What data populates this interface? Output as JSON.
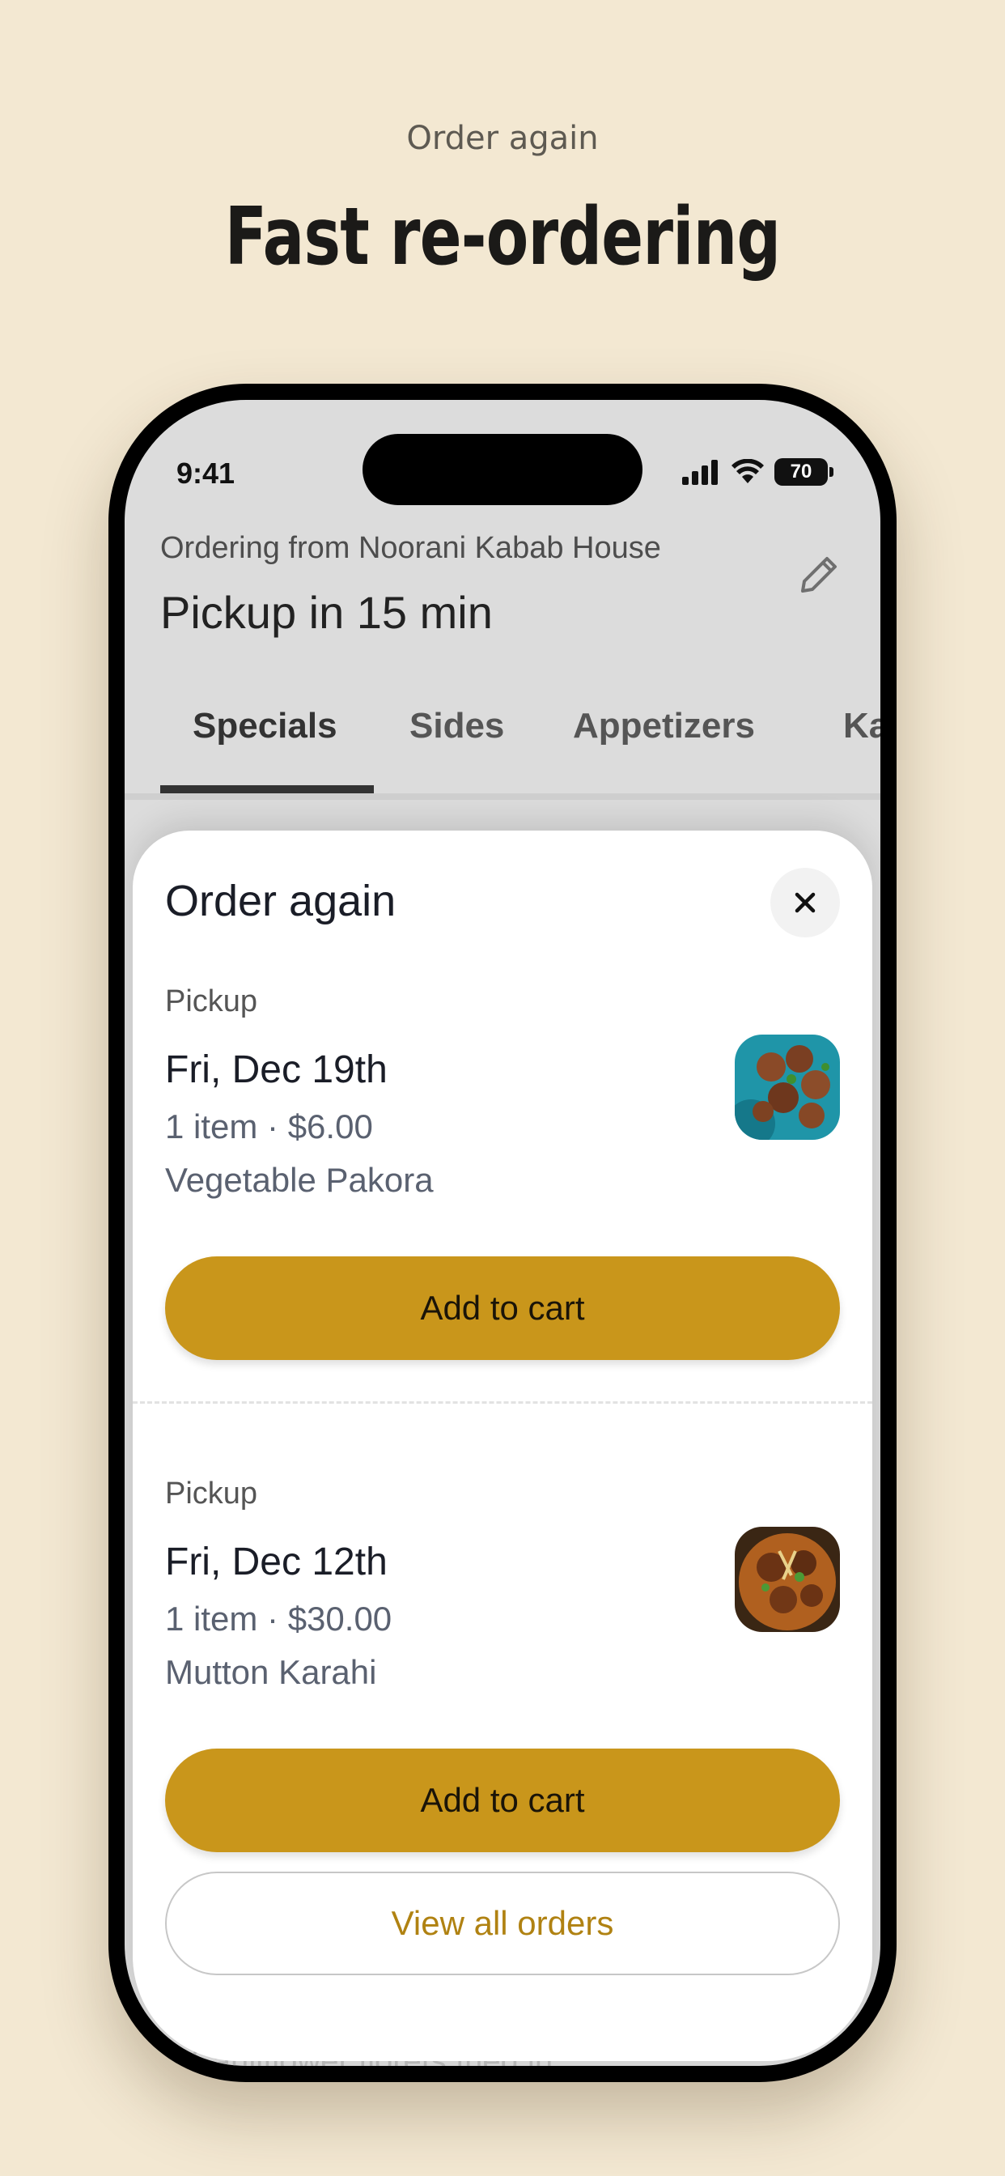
{
  "promo": {
    "kicker": "Order again",
    "headline": "Fast re-ordering"
  },
  "status_bar": {
    "time": "9:41",
    "battery": "70",
    "icons": [
      "signal-icon",
      "wifi-icon",
      "battery-icon"
    ]
  },
  "header": {
    "ordering_from": "Ordering from Noorani Kabab House",
    "pickup": "Pickup in 15 min",
    "edit_icon": "pencil-icon"
  },
  "tabs": [
    {
      "label": "Specials",
      "active": true
    },
    {
      "label": "Sides",
      "active": false
    },
    {
      "label": "Appetizers",
      "active": false
    },
    {
      "label": "Karahi",
      "active": false
    }
  ],
  "background_peek": "Cauliflower florets fried in",
  "sheet": {
    "title": "Order again",
    "close_icon": "close-icon",
    "orders": [
      {
        "mode": "Pickup",
        "date": "Fri, Dec 19th",
        "meta": "1 item · $6.00",
        "item": "Vegetable Pakora",
        "button": "Add to cart"
      },
      {
        "mode": "Pickup",
        "date": "Fri, Dec 12th",
        "meta": "1 item · $30.00",
        "item": "Mutton Karahi",
        "button": "Add to cart"
      }
    ],
    "view_all": "View all orders"
  },
  "colors": {
    "background": "#f3e8d2",
    "accent": "#c9961b",
    "link": "#b08212"
  }
}
